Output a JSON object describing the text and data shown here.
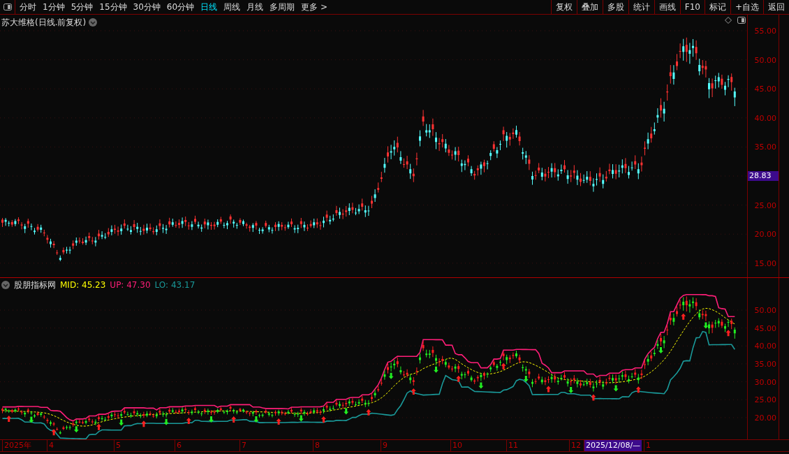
{
  "toolbar": {
    "periods": [
      {
        "label": "分时",
        "selected": false
      },
      {
        "label": "1分钟",
        "selected": false
      },
      {
        "label": "5分钟",
        "selected": false
      },
      {
        "label": "15分钟",
        "selected": false
      },
      {
        "label": "30分钟",
        "selected": false
      },
      {
        "label": "60分钟",
        "selected": false
      },
      {
        "label": "日线",
        "selected": true
      },
      {
        "label": "周线",
        "selected": false
      },
      {
        "label": "月线",
        "selected": false
      },
      {
        "label": "多周期",
        "selected": false
      }
    ],
    "more": "更多 >",
    "buttons": [
      "复权",
      "叠加",
      "多股",
      "统计",
      "画线",
      "F10",
      "标记",
      "+自选",
      "返回"
    ]
  },
  "main_chart": {
    "title": "苏大维格(日线.前复权)",
    "y_ticks": [
      "55.00",
      "50.00",
      "45.00",
      "40.00",
      "35.00",
      "25.00",
      "20.00",
      "15.00"
    ],
    "price_tag": "28.83"
  },
  "indicator": {
    "name": "股朋指标网",
    "legend": [
      {
        "text": "MID: 45.23",
        "color": "#ffff00"
      },
      {
        "text": "UP: 47.30",
        "color": "#ff1e78"
      },
      {
        "text": "LO: 43.17",
        "color": "#1a9a9a"
      }
    ],
    "y_ticks": [
      "50.00",
      "45.00",
      "40.00",
      "35.00",
      "30.00",
      "25.00",
      "20.00"
    ]
  },
  "date_axis": {
    "labels": [
      {
        "text": "2025年",
        "selected": false
      },
      {
        "text": "4",
        "selected": false
      },
      {
        "text": "5",
        "selected": false
      },
      {
        "text": "6",
        "selected": false
      },
      {
        "text": "7",
        "selected": false
      },
      {
        "text": "8",
        "selected": false
      },
      {
        "text": "9",
        "selected": false
      },
      {
        "text": "10",
        "selected": false
      },
      {
        "text": "11",
        "selected": false
      },
      {
        "text": "12",
        "selected": false
      },
      {
        "text": "2025/12/08/—",
        "selected": true
      },
      {
        "text": "1",
        "selected": false
      }
    ]
  }
}
